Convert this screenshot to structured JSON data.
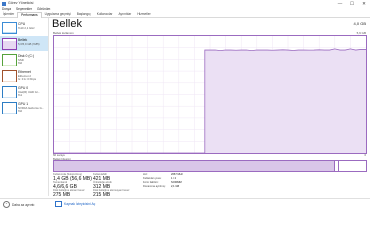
{
  "window": {
    "title": "Görev Yöneticisi",
    "controls": {
      "minimize": "—",
      "maximize": "☐",
      "close": "✕"
    }
  },
  "menu": [
    "Dosya",
    "Seçenekler",
    "Görünüm"
  ],
  "tabs": [
    {
      "label": "İşlemler",
      "active": false
    },
    {
      "label": "Performans",
      "active": true
    },
    {
      "label": "Uygulama geçmişi",
      "active": false
    },
    {
      "label": "Başlangıç",
      "active": false
    },
    {
      "label": "Kullanıcılar",
      "active": false
    },
    {
      "label": "Ayrıntılar",
      "active": false
    },
    {
      "label": "Hizmetler",
      "active": false
    }
  ],
  "sidebar": {
    "items": [
      {
        "name": "CPU",
        "sub": "%10 2,1 GHz",
        "sub2": "",
        "fill_fraction": 0.1,
        "fill_color": "#bcdcf4",
        "active": false,
        "kind": "cpu"
      },
      {
        "name": "Bellek",
        "sub": "5,0/5,9 GB (%85)",
        "sub2": "",
        "fill_fraction": 0.85,
        "fill_color": "#e7d7f2",
        "active": true,
        "kind": "mem"
      },
      {
        "name": "Disk 0 (C:)",
        "sub": "SSD",
        "sub2": "%0",
        "fill_fraction": 0.03,
        "fill_color": "#d6ecc9",
        "active": false,
        "kind": "disk"
      },
      {
        "name": "Ethernet",
        "sub": "Ethernet 2",
        "sub2": "G: 0 A: 0 Kbps",
        "fill_fraction": 0.05,
        "fill_color": "#f1ddd0",
        "active": false,
        "kind": "eth"
      },
      {
        "name": "GPU 0",
        "sub": "Intel(R) UHD Gr...",
        "sub2": "%1",
        "fill_fraction": 0.05,
        "fill_color": "#cfe3f4",
        "active": false,
        "kind": "gpu"
      },
      {
        "name": "GPU 1",
        "sub": "NVIDIA GeForce G...",
        "sub2": "%0",
        "fill_fraction": 0.02,
        "fill_color": "#cfe3f4",
        "active": false,
        "kind": "gpu"
      }
    ]
  },
  "main": {
    "title": "Bellek",
    "total": "4,0 GB",
    "usage_label": "Bellek kullanımı",
    "usage_max": "5,9 GB",
    "axis_left": "60 saniye",
    "axis_right": "0",
    "composition_label": "Bellek bileşimi",
    "stats": {
      "in_use": {
        "label": "Kullanımda (Sıkıştırılmış)",
        "value": "1,4 GB (56,6 MB)"
      },
      "available": {
        "label": "Kullanılabilir",
        "value": "421 MB"
      },
      "committed": {
        "label": "Tamamlandı",
        "value": "4,6/6,6 GB"
      },
      "cached": {
        "label": "Önbelleğe alındı",
        "value": "312 MB"
      },
      "paged_pool": {
        "label": "Disk belleğine alınan havuz",
        "value": "275 MB"
      },
      "nonpaged_pool": {
        "label": "Disk belleğine alınmayan havuz",
        "value": "215 MB"
      },
      "details": [
        {
          "k": "Hız:",
          "v": "2667 MHz"
        },
        {
          "k": "Kullanılan yuva:",
          "v": "1 / 2"
        },
        {
          "k": "Form faktörü:",
          "v": "SODIMM"
        },
        {
          "k": "Donanıma ayrılmış:",
          "v": "2,1 GB"
        }
      ]
    }
  },
  "chart_data": {
    "type": "area",
    "ylim": [
      0,
      100
    ],
    "x": [
      0,
      1,
      2,
      3,
      4,
      5,
      6,
      7,
      8,
      9,
      10,
      11,
      12,
      13,
      14,
      15,
      16,
      17,
      18,
      19,
      20,
      21,
      22,
      23,
      24,
      25,
      26,
      27,
      28,
      29,
      30,
      31,
      32,
      33,
      34,
      35,
      36,
      37,
      38,
      39,
      40,
      41,
      42,
      43,
      44,
      45,
      46,
      47,
      48,
      49,
      50,
      51,
      52,
      53,
      54,
      55,
      56,
      57,
      58,
      59,
      60
    ],
    "series": [
      {
        "values": [
          0,
          0,
          0,
          0,
          0,
          0,
          0,
          0,
          0,
          0,
          0,
          0,
          0,
          0,
          0,
          0,
          0,
          0,
          0,
          0,
          0,
          0,
          0,
          0,
          0,
          0,
          0,
          0,
          0,
          88,
          88,
          88,
          87.5,
          88,
          88,
          87.8,
          88,
          88,
          87.5,
          88,
          88,
          88,
          87.8,
          88,
          88.2,
          88,
          87.6,
          88,
          88,
          87.9,
          88,
          88.2,
          88,
          88,
          89,
          88,
          88,
          89,
          88,
          88.5,
          88.5
        ]
      }
    ]
  },
  "footer": {
    "less_details": "Daha az ayrıntı",
    "open_monitor": "Kaynak İzleyicisini Aç"
  },
  "colors": {
    "memory_accent": "#9b6bc0",
    "memory_fill": "#ebe0f4",
    "selected_bg": "#cfe6f7",
    "link": "#1b63c6"
  }
}
